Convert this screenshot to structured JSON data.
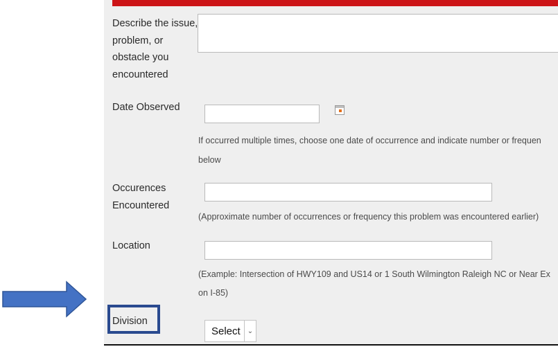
{
  "form": {
    "describe_label": "Describe the issue,\nproblem, or\nobstacle you\nencountered",
    "date_label": "Date Observed",
    "date_hint_line1": "If occurred multiple times, choose one date of occurrence and indicate number or frequen",
    "date_hint_line2": "below",
    "occ_label": "Occurences\nEncountered",
    "occ_hint": "(Approximate number of occurrences or frequency this problem was encountered earlier)",
    "location_label": "Location",
    "loc_hint_line1": "(Example: Intersection of HWY109 and US14 or 1 South Wilmington Raleigh NC or Near Ex",
    "loc_hint_line2": "on I-85)",
    "division_label": "Division",
    "division_select": "Select"
  },
  "colors": {
    "header_bar": "#cc1417",
    "arrow": "#4472c4",
    "highlight_box": "#2a4a8f"
  },
  "icons": [
    "calendar-icon",
    "chevron-down-icon",
    "arrow-right-icon"
  ]
}
